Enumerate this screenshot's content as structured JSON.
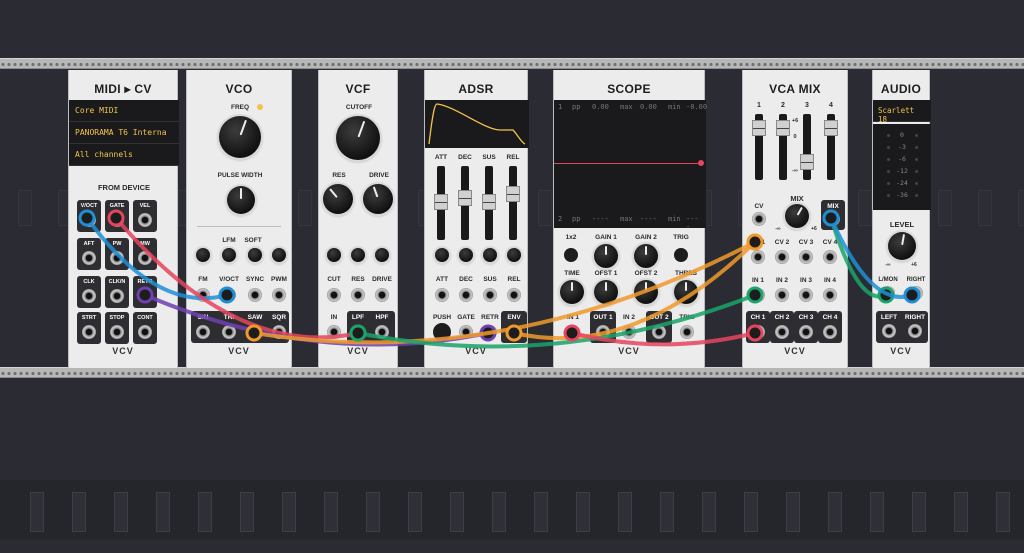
{
  "midi": {
    "title": "MIDI ▸ CV",
    "driver": "Core MIDI",
    "device": "PANORAMA T6 Interna",
    "channel": "All channels",
    "section": "FROM DEVICE",
    "jacks": [
      "V/OCT",
      "GATE",
      "VEL",
      "AFT",
      "PW",
      "MW",
      "CLK",
      "CLK/N",
      "RETR",
      "STRT",
      "STOP",
      "CONT"
    ],
    "brand": "VCV"
  },
  "vco": {
    "title": "VCO",
    "knobs": [
      "FREQ",
      "PULSE WIDTH"
    ],
    "switches": [
      "LFM",
      "SOFT"
    ],
    "cv_labels": [
      "FM",
      "V/OCT",
      "SYNC",
      "PWM"
    ],
    "out_labels": [
      "SIN",
      "TRI",
      "SAW",
      "SQR"
    ],
    "brand": "VCV"
  },
  "vcf": {
    "title": "VCF",
    "knobs": [
      "CUTOFF",
      "RES",
      "DRIVE"
    ],
    "cv_labels": [
      "CUT",
      "RES",
      "DRIVE"
    ],
    "io_labels": [
      "IN",
      "LPF",
      "HPF"
    ],
    "brand": "VCV"
  },
  "adsr": {
    "title": "ADSR",
    "sliders": [
      "ATT",
      "DEC",
      "SUS",
      "REL"
    ],
    "cv_labels": [
      "ATT",
      "DEC",
      "SUS",
      "REL"
    ],
    "io_labels": [
      "PUSH",
      "GATE",
      "RETR",
      "ENV"
    ],
    "brand": "VCV"
  },
  "scope": {
    "title": "SCOPE",
    "top_readout": [
      "1",
      "pp",
      "0.00",
      "max",
      "0.00",
      "min",
      "-0.00"
    ],
    "bottom_readout": [
      "2",
      "pp",
      "----",
      "max",
      "----",
      "min",
      "----"
    ],
    "knobs": [
      "1x2",
      "GAIN 1",
      "GAIN 2",
      "TRIG",
      "TIME",
      "OFST 1",
      "OFST 2",
      "THRES"
    ],
    "io_labels": [
      "IN 1",
      "OUT 1",
      "IN 2",
      "OUT 2",
      "TRIG"
    ],
    "brand": "VCV"
  },
  "vcamix": {
    "title": "VCA MIX",
    "channels": [
      "1",
      "2",
      "3",
      "4"
    ],
    "scale": [
      "+6",
      "0",
      "-∞"
    ],
    "mix_label": "MIX",
    "mix_scale": [
      "-∞",
      "+6"
    ],
    "cv_label": "CV",
    "mix_out": "MIX",
    "cv_row": [
      "CV 1",
      "CV 2",
      "CV 3",
      "CV 4"
    ],
    "in_row": [
      "IN 1",
      "IN 2",
      "IN 3",
      "IN 4"
    ],
    "ch_row": [
      "CH 1",
      "CH 2",
      "CH 3",
      "CH 4"
    ],
    "brand": "VCV"
  },
  "audio": {
    "title": "AUDIO",
    "device": "Scarlett 18",
    "meter": [
      "0",
      "-3",
      "-6",
      "-12",
      "-24",
      "-36"
    ],
    "level_label": "LEVEL",
    "level_scale": [
      "-∞",
      "+6"
    ],
    "in_labels": [
      "L/MON",
      "RIGHT"
    ],
    "out_labels": [
      "LEFT",
      "RIGHT"
    ],
    "brand": "VCV"
  },
  "colors": {
    "blue": "#1e8fd6",
    "red": "#e5455f",
    "purple": "#6f41b0",
    "green": "#1aa36a",
    "orange": "#f09a2b",
    "yellow": "#f3c24b"
  }
}
